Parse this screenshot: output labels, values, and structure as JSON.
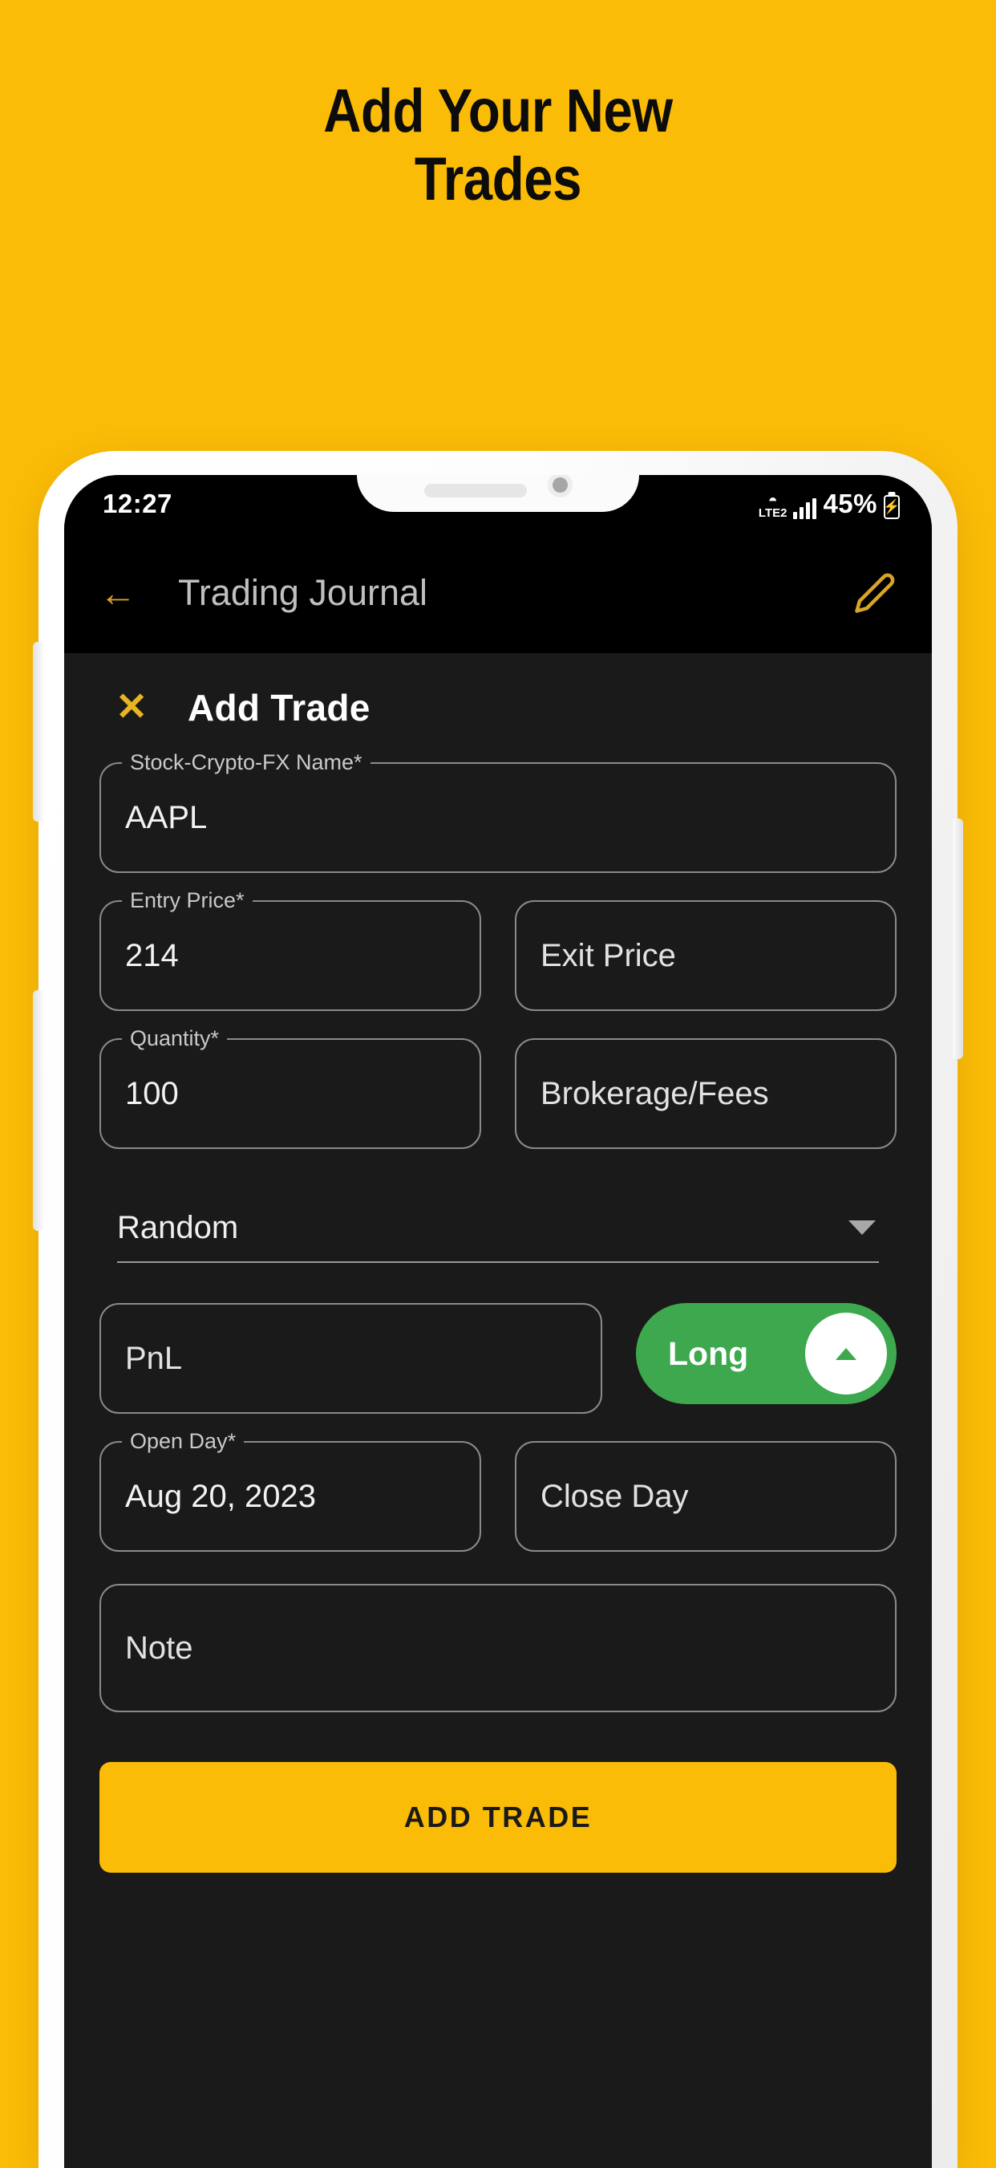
{
  "promo": {
    "heading_line1": "Add Your New",
    "heading_line2": "Trades",
    "background_color": "#FBBC07",
    "text_color": "#0C0C0C"
  },
  "status_bar": {
    "time": "12:27",
    "network_label": "LTE2",
    "wifi_icon": "wifi-icon",
    "signal_icon": "signal-bars-icon",
    "battery_percent": "45%",
    "battery_icon": "battery-charging-icon"
  },
  "app_bar": {
    "back_icon": "back-arrow-icon",
    "title": "Trading Journal",
    "edit_icon": "pencil-edit-icon",
    "accent_color": "#D9A528"
  },
  "sheet": {
    "close_icon": "close-x-icon",
    "title": "Add Trade",
    "fields": {
      "symbol": {
        "label": "Stock-Crypto-FX Name*",
        "value": "AAPL",
        "placeholder": "Stock-Crypto-FX Name*"
      },
      "entry_price": {
        "label": "Entry Price*",
        "value": "214",
        "placeholder": "Entry Price*"
      },
      "exit_price": {
        "label": "",
        "value": "",
        "placeholder": "Exit Price"
      },
      "quantity": {
        "label": "Quantity*",
        "value": "100",
        "placeholder": "Quantity*"
      },
      "brokerage_fees": {
        "label": "",
        "value": "",
        "placeholder": "Brokerage/Fees"
      },
      "strategy": {
        "selected": "Random",
        "caret_icon": "chevron-down-icon"
      },
      "pnl": {
        "label": "",
        "value": "",
        "placeholder": "PnL"
      },
      "direction_toggle": {
        "label": "Long",
        "state": "on",
        "color": "#3DA84E",
        "thumb_icon": "caret-up-icon"
      },
      "open_day": {
        "label": "Open Day*",
        "value": "Aug 20, 2023",
        "placeholder": "Open Day*"
      },
      "close_day": {
        "label": "",
        "value": "",
        "placeholder": "Close Day"
      },
      "note": {
        "label": "",
        "value": "",
        "placeholder": "Note"
      }
    },
    "submit_button": {
      "label": "ADD TRADE",
      "color": "#FBBC07"
    }
  }
}
